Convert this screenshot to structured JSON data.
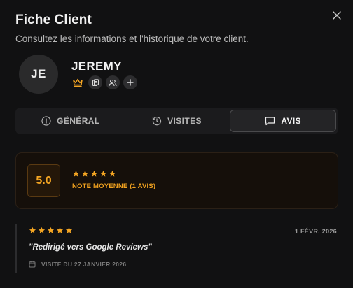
{
  "modal": {
    "title": "Fiche Client",
    "subtitle": "Consultez les informations et l'historique de votre client."
  },
  "client": {
    "initials": "JE",
    "name": "JEREMY",
    "badges": [
      "crown-icon",
      "card-icon",
      "users-icon",
      "plus-icon"
    ]
  },
  "tabs": [
    {
      "label": "GÉNÉRAL",
      "icon": "info-icon",
      "active": false
    },
    {
      "label": "VISITES",
      "icon": "history-icon",
      "active": false
    },
    {
      "label": "AVIS",
      "icon": "message-icon",
      "active": true
    }
  ],
  "rating": {
    "score": "5.0",
    "stars": 5,
    "label": "NOTE MOYENNE (1 AVIS)"
  },
  "reviews": [
    {
      "stars": 5,
      "date": "1 FÉVR. 2026",
      "text": "\"Redirigé vers Google Reviews\"",
      "visit": "VISITE DU 27 JANVIER 2026"
    }
  ],
  "colors": {
    "accent": "#f5a623",
    "background": "#111112"
  }
}
